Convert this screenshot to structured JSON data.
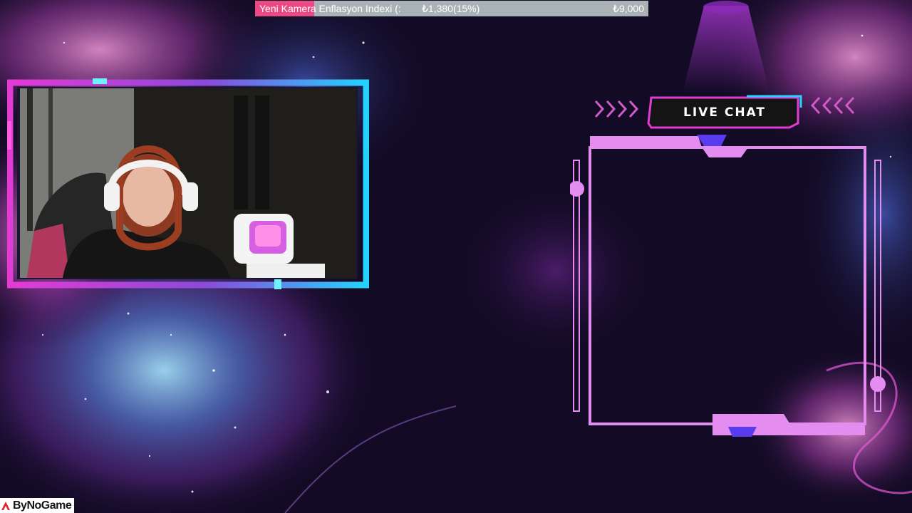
{
  "donation_goal": {
    "title": "Yeni Kamera Enflasyon Indexi (:",
    "progress_text": "₺1,380(15%)",
    "target_text": "₺9,000",
    "progress_fraction": 0.15,
    "fill_color": "#ea4a84",
    "track_color": "#a9b3b5"
  },
  "webcam": {
    "frame_colors": [
      "#e23bd3",
      "#23d3ff"
    ]
  },
  "live_chat": {
    "title": "LIVE CHAT",
    "frame_color": "#e58cf0",
    "accent_color": "#5a3cf0"
  },
  "branding": {
    "logo_text": "ByNoGame",
    "logo_icon": "bynogame-logo-icon"
  },
  "background": {
    "theme": "purple-galaxy-nebula"
  }
}
